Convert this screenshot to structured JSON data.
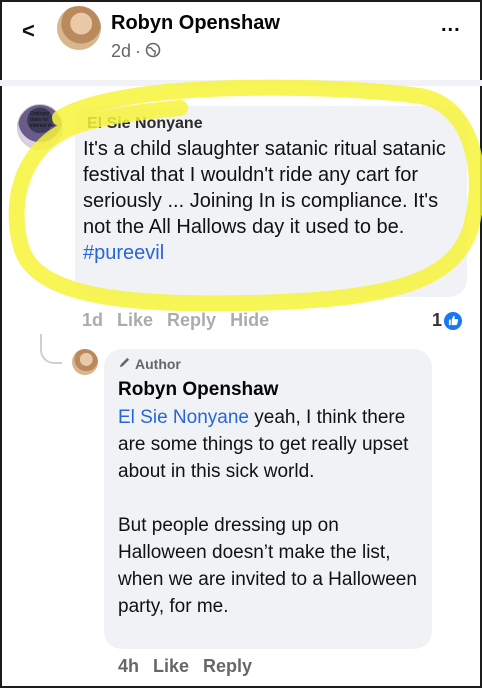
{
  "header": {
    "back_label": "<",
    "name": "Robyn Openshaw",
    "time": "2d",
    "separator": "·",
    "visibility_icon": "globe-icon",
    "more_label": "..."
  },
  "comment1": {
    "avatar_text": "Ordinary does no interest me",
    "author": "El Sie Nonyane",
    "text": "It's a child slaughter satanic ritual satanic festival that I wouldn't ride any cart for seriously ... Joining In is compliance. It's not the All Hallows day it used to be.",
    "hashtag": "#pureevil",
    "time": "1d",
    "like_label": "Like",
    "reply_label": "Reply",
    "hide_label": "Hide",
    "like_count": "1",
    "like_icon": "thumbs-up-icon"
  },
  "reply": {
    "badge_icon": "pencil-icon",
    "badge_label": "Author",
    "author": "Robyn Openshaw",
    "mention": "El Sie Nonyane",
    "text1": " yeah, I think there are some things to get really upset about in this sick world.",
    "text2": "But people dressing up on Halloween doesn’t make the list, when we are invited to a Halloween party, for me.",
    "time": "4h",
    "like_label": "Like",
    "reply_label": "Reply"
  },
  "colors": {
    "link": "#2766d8",
    "bubble": "#f0f2f5",
    "meta": "#65676b",
    "highlighter": "#f7f33a",
    "like_badge": "#1877f2"
  }
}
